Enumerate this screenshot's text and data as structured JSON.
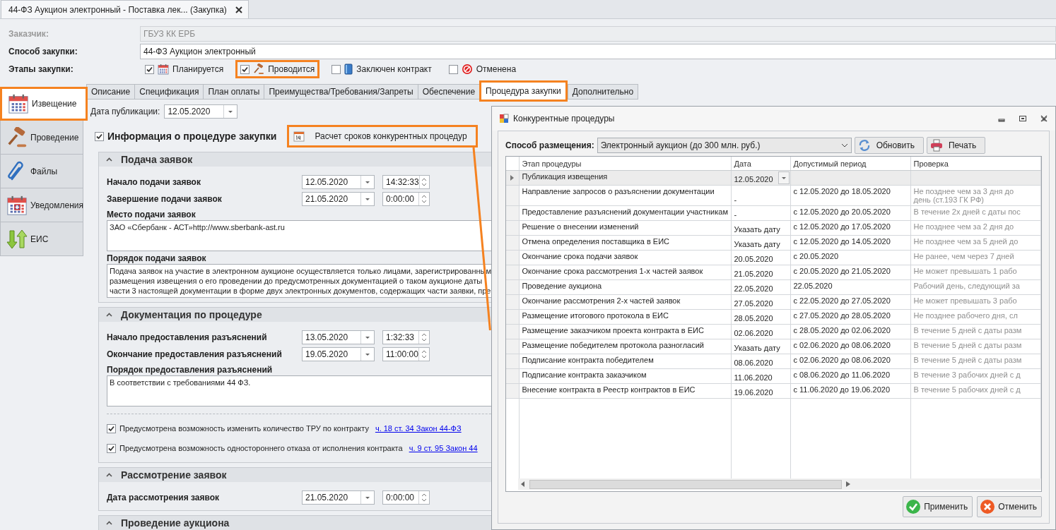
{
  "document_tab": {
    "title": "44-ФЗ Аукцион электронный - Поставка лек... (Закупка)",
    "selected": true
  },
  "header": {
    "customer": {
      "label": "Заказчик:",
      "value": "ГБУЗ КК ЕРБ",
      "disabled": true
    },
    "method": {
      "label": "Способ закупки:",
      "value": "44-ФЗ Аукцион электронный",
      "disabled": false
    },
    "stages": {
      "label": "Этапы закупки:",
      "items": [
        {
          "label": "Планируется",
          "checked": true,
          "highlighted": false
        },
        {
          "label": "Проводится",
          "checked": true,
          "highlighted": true
        },
        {
          "label": "Заключен контракт",
          "checked": false,
          "highlighted": false
        },
        {
          "label": "Отменена",
          "checked": false,
          "highlighted": false
        }
      ]
    }
  },
  "nav": [
    {
      "label": "Извещение",
      "selected": true,
      "highlighted": true
    },
    {
      "label": "Проведение",
      "selected": false,
      "highlighted": false
    },
    {
      "label": "Файлы",
      "selected": false,
      "highlighted": false
    },
    {
      "label": "Уведомления",
      "selected": false,
      "highlighted": false
    },
    {
      "label": "ЕИС",
      "selected": false,
      "highlighted": false
    }
  ],
  "tabs": [
    {
      "label": "Описание",
      "selected": false,
      "highlighted": false
    },
    {
      "label": "Спецификация",
      "selected": false,
      "highlighted": false
    },
    {
      "label": "План оплаты",
      "selected": false,
      "highlighted": false
    },
    {
      "label": "Преимущества/Требования/Запреты",
      "selected": false,
      "highlighted": false
    },
    {
      "label": "Обеспечение",
      "selected": false,
      "highlighted": false
    },
    {
      "label": "Процедура закупки",
      "selected": true,
      "highlighted": true
    },
    {
      "label": "Дополнительно",
      "selected": false,
      "highlighted": false
    }
  ],
  "publication_date": {
    "label": "Дата публикации:",
    "value": "12.05.2020"
  },
  "procedure_info": {
    "label": "Информация о процедуре закупки",
    "checked": true
  },
  "calc_button": {
    "label": "Расчет сроков конкурентных процедур",
    "highlighted": true
  },
  "sections": [
    {
      "title": "Подача заявок",
      "expanded": true,
      "items": [
        {
          "kind": "datetime",
          "label": "Начало подачи заявок",
          "date": "12.05.2020",
          "time": "14:32:33"
        },
        {
          "kind": "datetime",
          "label": "Завершение подачи заявок",
          "date": "21.05.2020",
          "time": "0:00:00"
        },
        {
          "kind": "memo",
          "label": "Место подачи заявок",
          "lines": [
            "ЗАО «Сбербанк - АСТ»http://www.sberbank-ast.ru"
          ]
        },
        {
          "kind": "memo",
          "label": "Порядок подачи заявок",
          "lines": [
            "Подача заявок на участие в электронном аукционе осуществляется только лицами, зарегистрированным",
            "размещения извещения о его проведении до предусмотренных документацией о таком аукционе даты",
            "части 3 настоящей документации в форме двух электронных документов, содержащих части заявки, пре"
          ]
        }
      ]
    },
    {
      "title": "Документация по процедуре",
      "expanded": true,
      "items": [
        {
          "kind": "datetime",
          "label": "Начало предоставления разъяснений",
          "date": "13.05.2020",
          "time": "1:32:33"
        },
        {
          "kind": "datetime",
          "label": "Окончание предоставления разъяснений",
          "date": "19.05.2020",
          "time": "11:00:00"
        },
        {
          "kind": "memo",
          "label": "Порядок предоставления разъяснений",
          "lines": [
            "В соответствии с требованиями 44 ФЗ."
          ]
        },
        {
          "kind": "check",
          "label": "Предусмотрена возможность изменить количество ТРУ по контракту",
          "checked": true,
          "link": "ч. 18 ст. 34 Закон 44-ФЗ"
        },
        {
          "kind": "check",
          "label": "Предусмотрена возможность одностороннего отказа от исполнения контракта",
          "checked": true,
          "link": "ч. 9 ст. 95 Закон 44"
        }
      ]
    },
    {
      "title": "Рассмотрение заявок",
      "expanded": true,
      "items": [
        {
          "kind": "datetime",
          "label": "Дата рассмотрения заявок",
          "date": "21.05.2020",
          "time": "0:00:00"
        }
      ]
    },
    {
      "title": "Проведение аукциона",
      "expanded": true
    }
  ],
  "dialog": {
    "title": "Конкурентные процедуры",
    "placement": {
      "label": "Способ размещения:",
      "value": "Электронный аукцион (до 300 млн. руб.)"
    },
    "refresh_button": "Обновить",
    "print_button": "Печать",
    "grid": {
      "columns": [
        "Этап процедуры",
        "Дата",
        "Допустимый период",
        "Проверка"
      ],
      "rows": [
        {
          "stage": "Публикация извещения",
          "date": "12.05.2020",
          "selected": true
        },
        {
          "stage": "Направление запросов о разъяснении документации",
          "date": "-",
          "period": "с 12.05.2020 до 18.05.2020",
          "check": [
            "Не позднее чем за 3 дня до",
            "день (ст.193 ГК РФ)"
          ],
          "selected": false
        },
        {
          "stage": "Предоставление разъяснений документации участникам",
          "date": "-",
          "period": "с 12.05.2020 до 20.05.2020",
          "check": [
            "В течение 2х дней с даты пос"
          ],
          "selected": false
        },
        {
          "stage": "Решение о внесении изменений",
          "date": "Указать дату",
          "period": "с 12.05.2020 до 17.05.2020",
          "check": [
            "Не позднее чем за 2 дня до"
          ],
          "selected": false
        },
        {
          "stage": "Отмена определения поставщика в ЕИС",
          "date": "Указать дату",
          "period": "с 12.05.2020 до 14.05.2020",
          "check": [
            "Не позднее чем за 5 дней до"
          ],
          "selected": false
        },
        {
          "stage": "Окончание срока подачи заявок",
          "date": "20.05.2020",
          "period": "с 20.05.2020",
          "check": [
            "Не ранее, чем через 7 дней"
          ],
          "selected": false
        },
        {
          "stage": "Окончание срока рассмотрения 1-х частей заявок",
          "date": "21.05.2020",
          "period": "с 20.05.2020 до 21.05.2020",
          "check": [
            "Не может превышать 1 рабо"
          ],
          "selected": false
        },
        {
          "stage": "Проведение аукциона",
          "date": "22.05.2020",
          "period": "22.05.2020",
          "check": [
            "Рабочий день, следующий за"
          ],
          "selected": false
        },
        {
          "stage": "Окончание рассмотрения 2-х частей заявок",
          "date": "27.05.2020",
          "period": "с 22.05.2020 до 27.05.2020",
          "check": [
            "Не может превышать 3 рабо"
          ],
          "selected": false
        },
        {
          "stage": "Размещение итогового протокола в ЕИС",
          "date": "28.05.2020",
          "period": "с 27.05.2020 до 28.05.2020",
          "check": [
            "Не позднее рабочего дня, сл"
          ],
          "selected": false
        },
        {
          "stage": "Размещение заказчиком проекта контракта в ЕИС",
          "date": "02.06.2020",
          "period": "с 28.05.2020 до 02.06.2020",
          "check": [
            "В течение 5 дней с даты разм"
          ],
          "selected": false
        },
        {
          "stage": "Размещение победителем протокола разногласий",
          "date": "Указать дату",
          "period": "с 02.06.2020 до 08.06.2020",
          "check": [
            "В течение 5 дней с даты разм"
          ],
          "selected": false
        },
        {
          "stage": "Подписание контракта победителем",
          "date": "08.06.2020",
          "period": "с 02.06.2020 до 08.06.2020",
          "check": [
            "В течение 5 дней с даты разм"
          ],
          "selected": false
        },
        {
          "stage": "Подписание контракта заказчиком",
          "date": "11.06.2020",
          "period": "с 08.06.2020 до 11.06.2020",
          "check": [
            "В течение 3 рабочих дней с д"
          ],
          "selected": false
        },
        {
          "stage": "Внесение контракта в Реестр контрактов в ЕИС",
          "date": "19.06.2020",
          "period": "с 11.06.2020 до 19.06.2020",
          "check": [
            "В течение 5 рабочих дней с д"
          ],
          "selected": false
        }
      ]
    },
    "apply_button": "Применить",
    "cancel_button": "Отменить"
  }
}
